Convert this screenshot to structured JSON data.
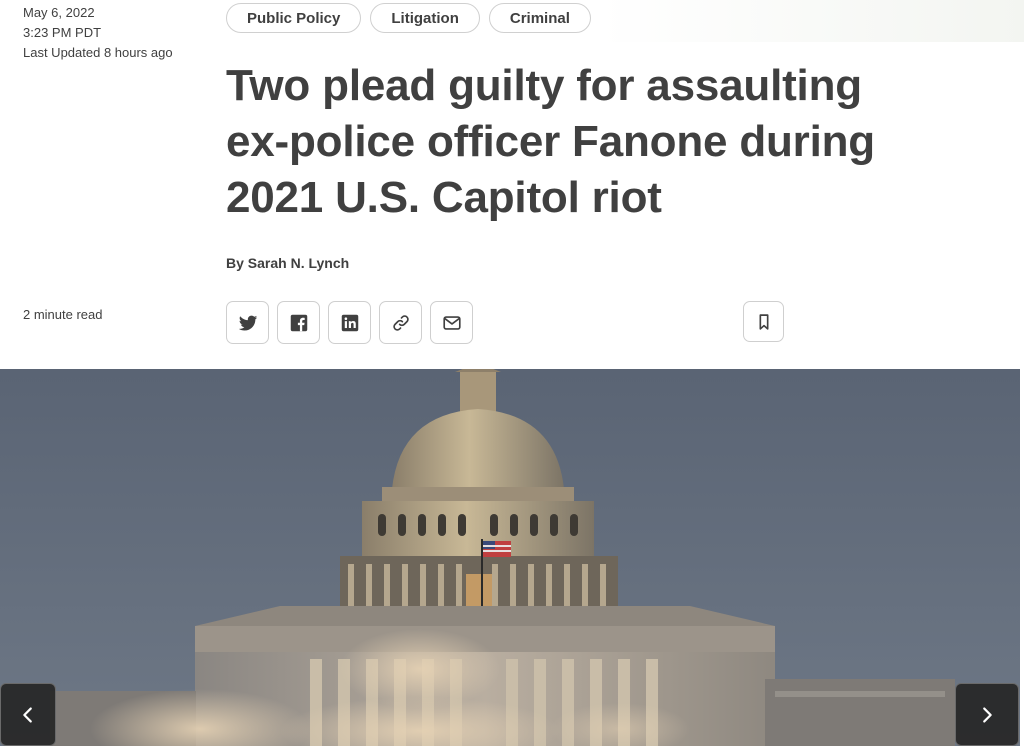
{
  "article": {
    "date": "May 6, 2022",
    "time": "3:23 PM PDT",
    "updated": "Last Updated 8 hours ago",
    "read_time": "2 minute read",
    "tags": [
      "Public Policy",
      "Litigation",
      "Criminal"
    ],
    "headline": "Two plead guilty for assaulting ex-police officer Fanone during 2021 U.S. Capitol riot",
    "byline_prefix": "By ",
    "author": "Sarah N. Lynch"
  },
  "share_icons": [
    "twitter-icon",
    "facebook-icon",
    "linkedin-icon",
    "link-icon",
    "email-icon"
  ],
  "bookmark_icon": "bookmark-icon",
  "gallery": {
    "prev_icon": "chevron-left-icon",
    "next_icon": "chevron-right-icon"
  },
  "colors": {
    "text": "#404040",
    "border": "#d0d0d0",
    "sky": "#5d6878"
  }
}
